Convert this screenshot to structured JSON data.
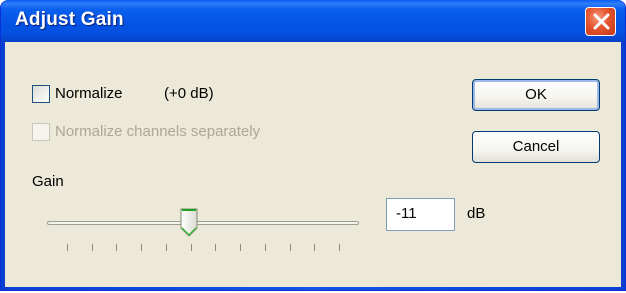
{
  "window": {
    "title": "Adjust Gain"
  },
  "normalize": {
    "label": "Normalize",
    "checked": false,
    "db_display": "(+0 dB)"
  },
  "normalize_separately": {
    "label": "Normalize channels separately",
    "checked": false,
    "enabled": false
  },
  "gain": {
    "label": "Gain",
    "value": "-11",
    "unit": "dB",
    "slider_level": 0.45,
    "tick_count": 12
  },
  "buttons": {
    "ok_label": "OK",
    "cancel_label": "Cancel"
  },
  "colors": {
    "titlebar": "#0453e6",
    "dialog_bg": "#ece9d8",
    "close_button": "#e4532c",
    "disabled_text": "#aca899"
  },
  "icons": {
    "close": "close-icon",
    "slider_thumb": "slider-thumb-icon"
  }
}
